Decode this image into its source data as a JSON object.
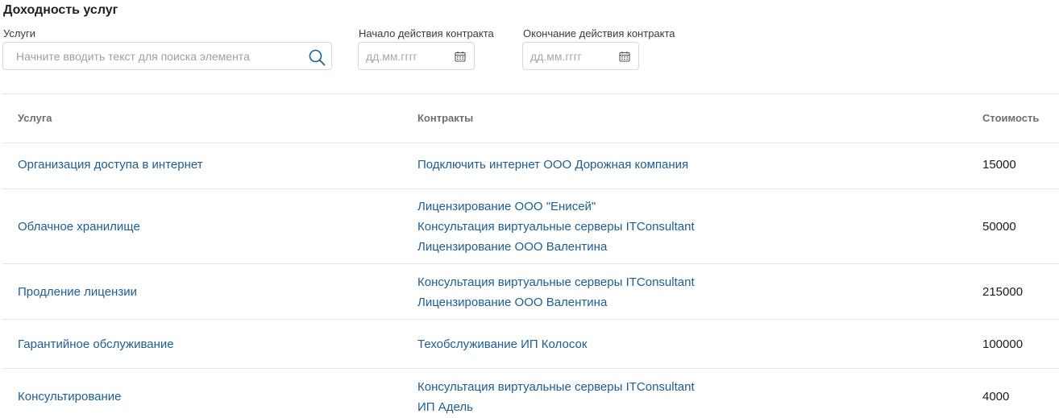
{
  "page": {
    "title": "Доходность услуг"
  },
  "filters": {
    "services_label": "Услуги",
    "services_placeholder": "Начните вводить текст для поиска элемента",
    "start_label": "Начало действия контракта",
    "start_placeholder": "дд.мм.гггг",
    "end_label": "Окончание действия контракта",
    "end_placeholder": "дд.мм.гггг"
  },
  "table": {
    "headers": {
      "service": "Услуга",
      "contracts": "Контракты",
      "cost": "Стоимость"
    },
    "rows": [
      {
        "service": "Организация доступа в интернет",
        "contracts": [
          "Подключить интернет ООО Дорожная компания"
        ],
        "cost": "15000"
      },
      {
        "service": "Облачное хранилище",
        "contracts": [
          "Лицензирование ООО \"Енисей\"",
          "Консультация виртуальные серверы ITConsultant",
          "Лицензирование ООО Валентина"
        ],
        "cost": "50000"
      },
      {
        "service": "Продление лицензии",
        "contracts": [
          "Консультация виртуальные серверы ITConsultant",
          "Лицензирование ООО Валентина"
        ],
        "cost": "215000"
      },
      {
        "service": "Гарантийное обслуживание",
        "contracts": [
          "Техобслуживание ИП Колосок"
        ],
        "cost": "100000"
      },
      {
        "service": "Консультирование",
        "contracts": [
          "Консультация виртуальные серверы ITConsultant",
          "ИП Адель"
        ],
        "cost": "4000"
      }
    ]
  },
  "colors": {
    "link": "#1b5e93",
    "border": "#d5d8dc",
    "divider": "#e3e5e8",
    "header_text": "#6f6f6f"
  }
}
